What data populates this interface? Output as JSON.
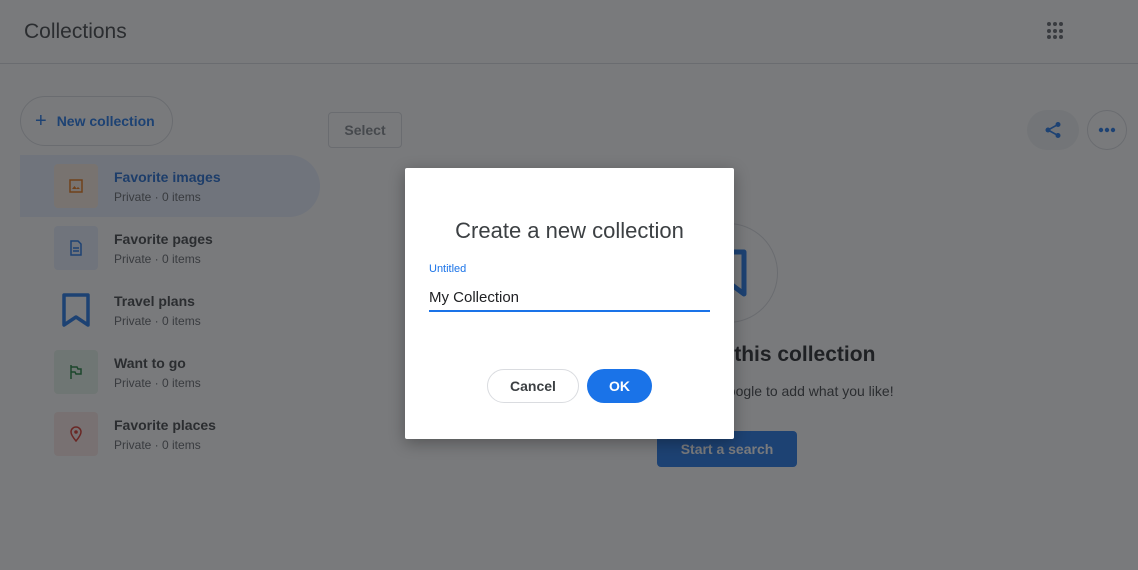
{
  "header": {
    "title": "Collections",
    "apps_icon": "apps-grid-icon"
  },
  "sidebar": {
    "new_collection_label": "New collection",
    "items": [
      {
        "title": "Favorite images",
        "subtitle": "Private · 0 items",
        "icon": "image-icon",
        "color": "#e8710a",
        "bg": "#fdeee0",
        "active": true
      },
      {
        "title": "Favorite pages",
        "subtitle": "Private · 0 items",
        "icon": "document-icon",
        "color": "#1a73e8",
        "bg": "#e8f0fe",
        "active": false
      },
      {
        "title": "Travel plans",
        "subtitle": "Private · 0 items",
        "icon": "bookmark-icon",
        "color": "#1a73e8",
        "bg": "transparent",
        "active": false
      },
      {
        "title": "Want to go",
        "subtitle": "Private · 0 items",
        "icon": "flag-icon",
        "color": "#188038",
        "bg": "#e6f4ea",
        "active": false
      },
      {
        "title": "Favorite places",
        "subtitle": "Private · 0 items",
        "icon": "pin-icon",
        "color": "#d93025",
        "bg": "#fce8e6",
        "active": false
      }
    ]
  },
  "toolbar": {
    "select_label": "Select"
  },
  "empty_state": {
    "title": "Nothing in this collection",
    "subtitle": "Start a search on Google to add what you like!",
    "button_label": "Start a search"
  },
  "dialog": {
    "title": "Create a new collection",
    "field_label": "Untitled",
    "field_value": "My Collection",
    "cancel_label": "Cancel",
    "ok_label": "OK"
  },
  "colors": {
    "accent": "#1a73e8",
    "text": "#3c4043"
  }
}
